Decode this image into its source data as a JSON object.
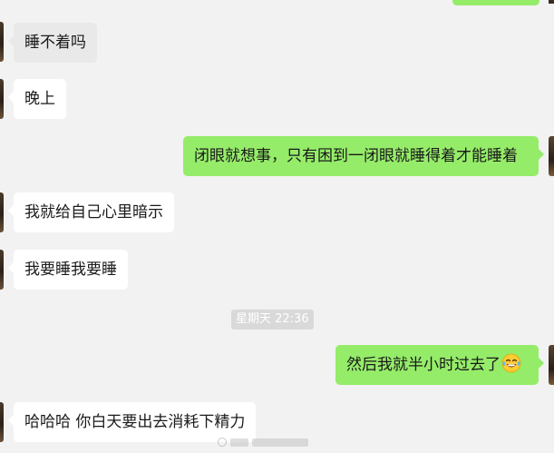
{
  "chat": {
    "messages": [
      {
        "side": "in",
        "text": "睡不着吗"
      },
      {
        "side": "in",
        "text": "晚上"
      },
      {
        "side": "out",
        "text": "闭眼就想事，只有困到一闭眼就睡得着才能睡着"
      },
      {
        "side": "in",
        "text": "我就给自己心里暗示"
      },
      {
        "side": "in",
        "text": "我要睡我要睡"
      },
      {
        "side": "out",
        "text": "然后我就半小时过去了",
        "emoji": "laughing-tears-emoji"
      },
      {
        "side": "in",
        "text": "哈哈哈 你白天要出去消耗下精力"
      }
    ],
    "timestamp": "星期天 22:36"
  },
  "colors": {
    "background": "#f2f2f2",
    "incoming_bubble": "#ffffff",
    "outgoing_bubble": "#95ec69",
    "timestamp_bg": "#d9d9d9"
  }
}
